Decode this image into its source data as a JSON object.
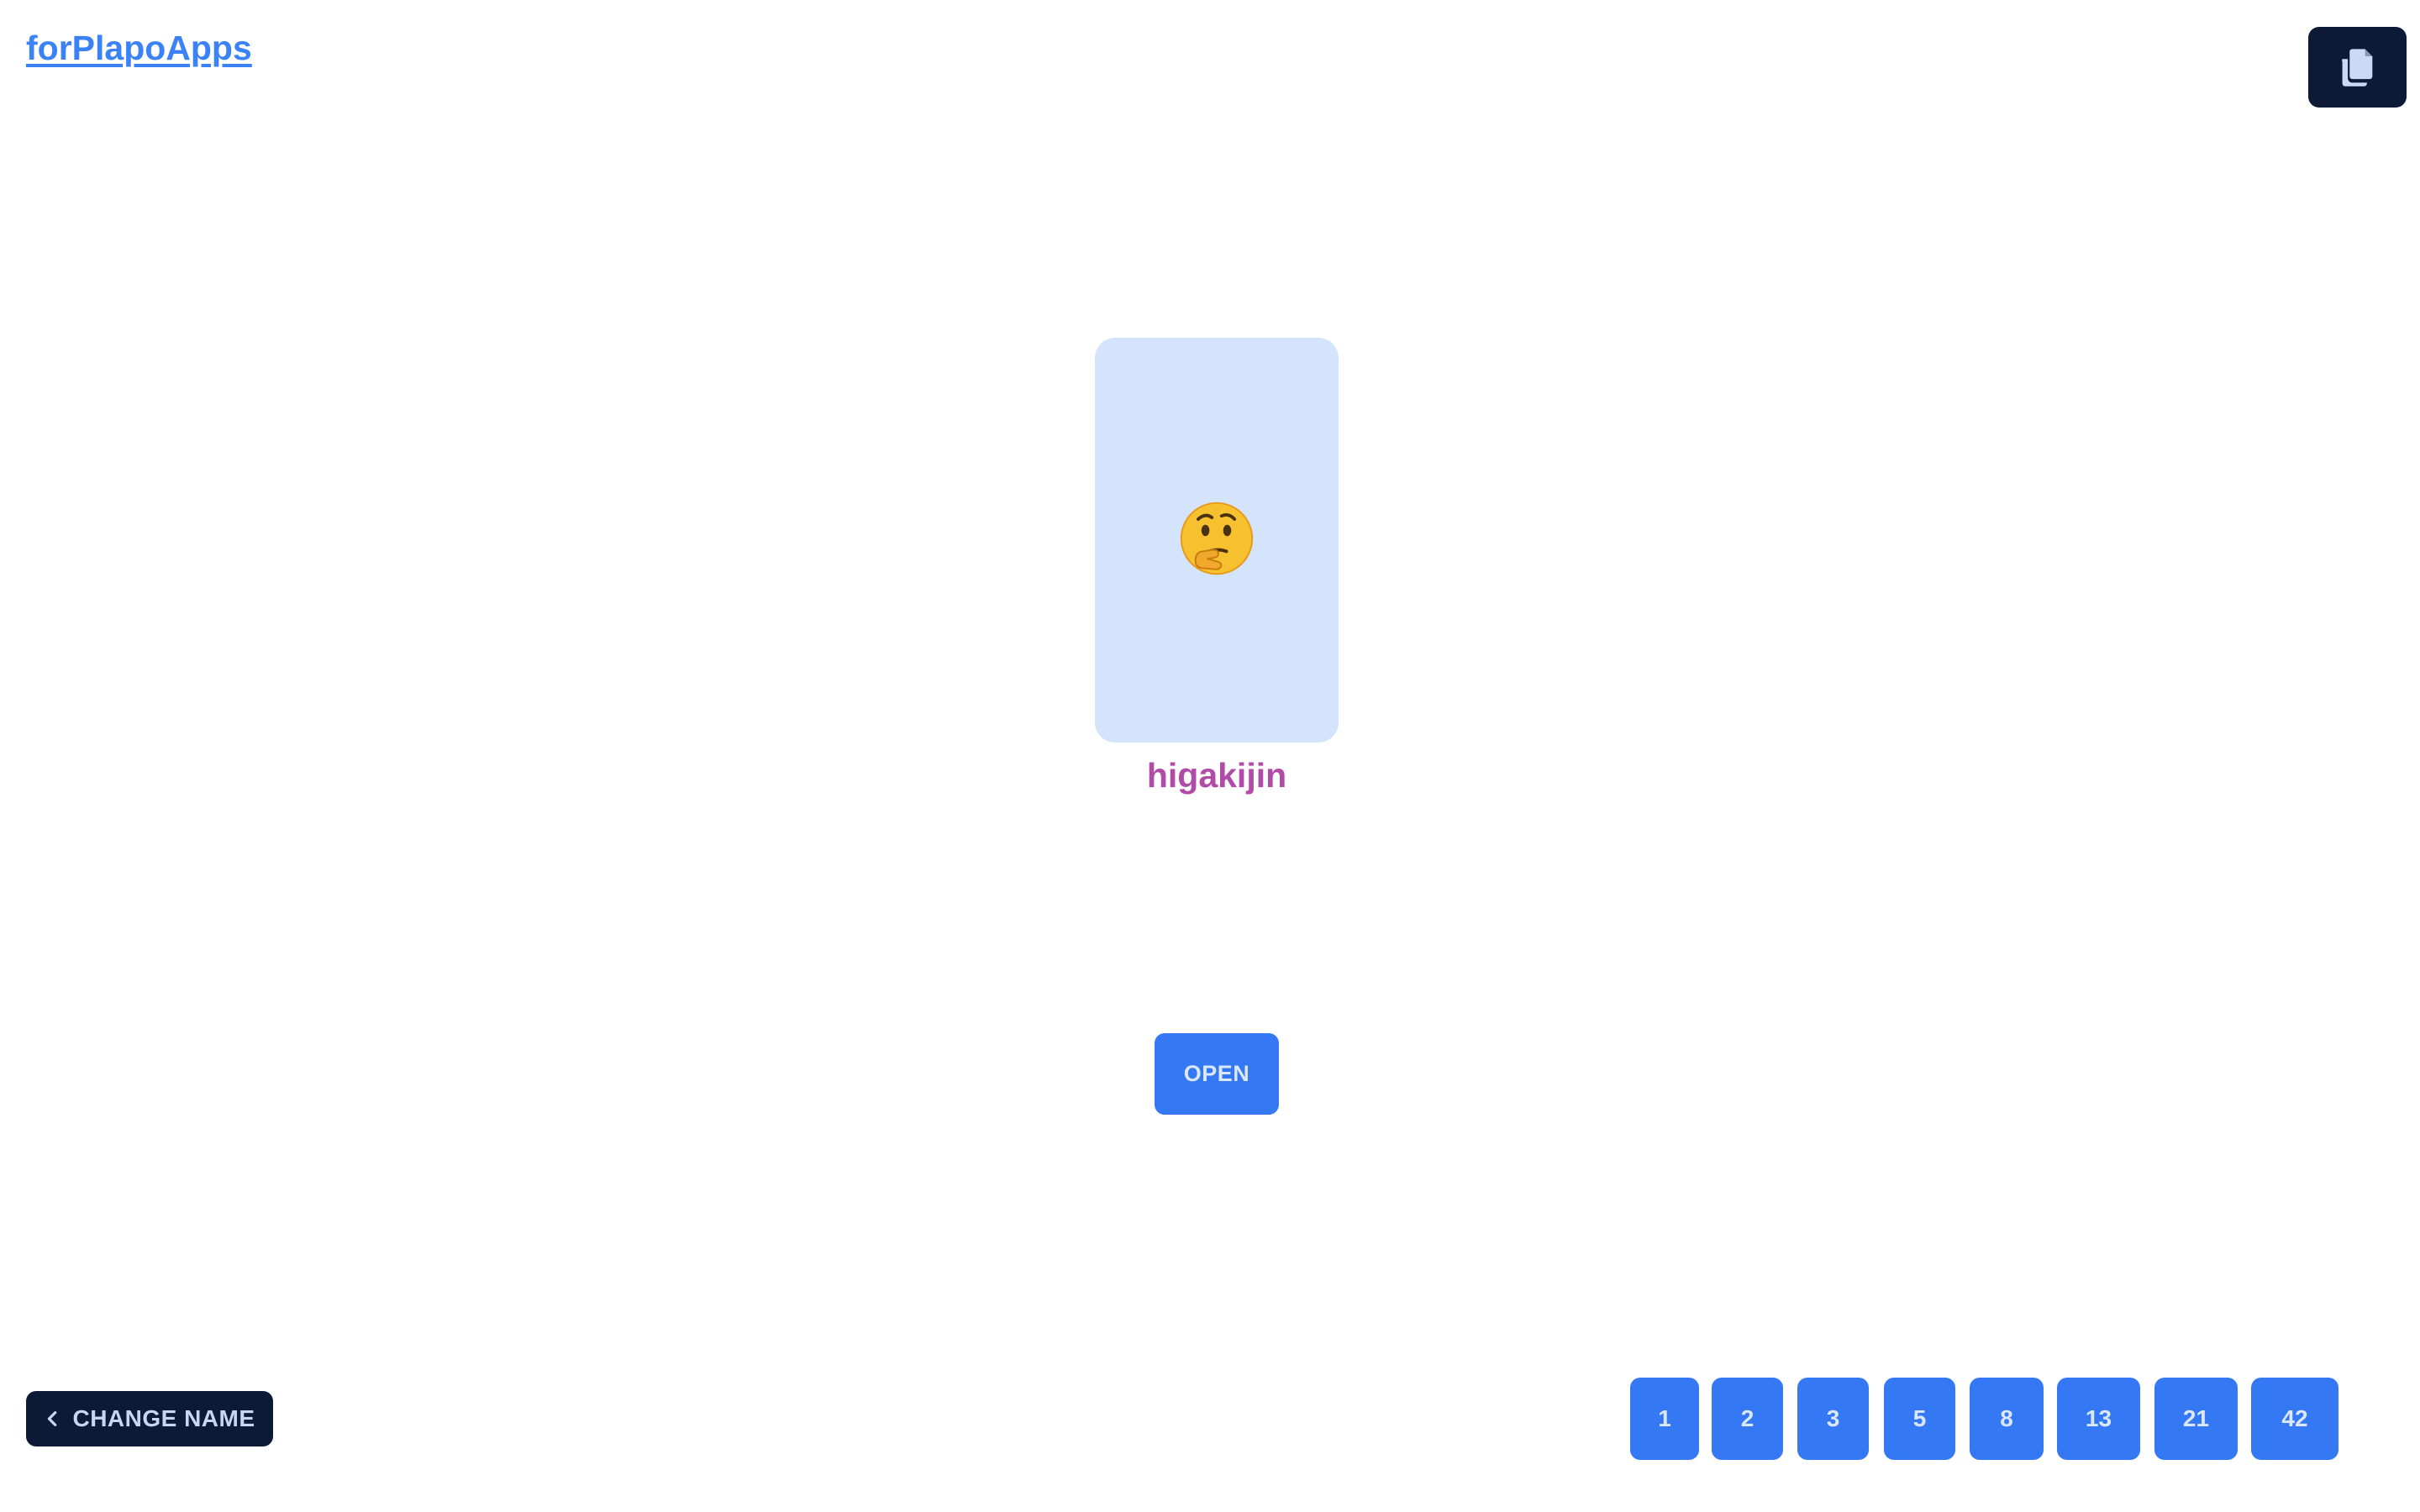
{
  "header": {
    "brand_label": "forPlapoApps",
    "copy_icon": "copy-icon"
  },
  "card": {
    "emoji": "🤔",
    "emoji_icon": "thinking-face-icon",
    "player_name": "higakijin"
  },
  "actions": {
    "open_label": "OPEN",
    "change_name_label": "CHANGE NAME",
    "change_name_icon": "chevron-left-icon"
  },
  "points": [
    "1",
    "2",
    "3",
    "5",
    "8",
    "13",
    "21",
    "42"
  ],
  "colors": {
    "accent": "#3478f4",
    "dark": "#0c1a36",
    "card": "#d3e4fc",
    "name": "#b04ba7",
    "link": "#3b82f6"
  }
}
